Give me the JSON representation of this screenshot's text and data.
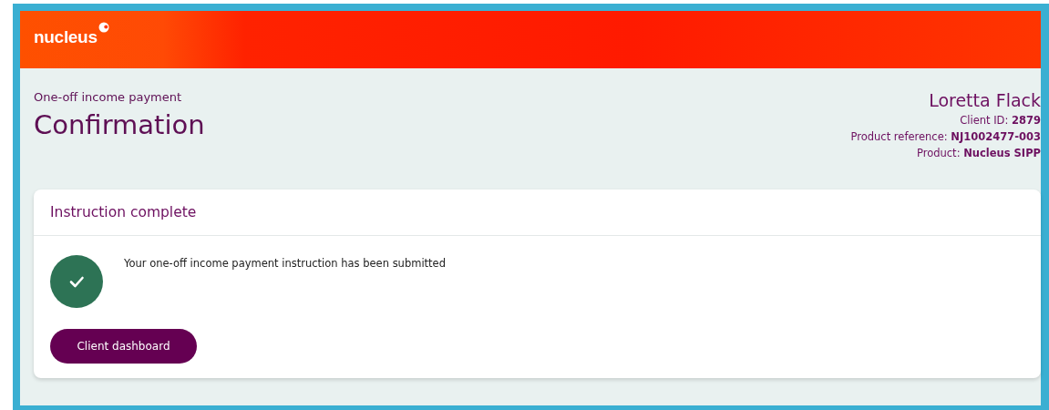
{
  "header": {
    "logo": "nucleus"
  },
  "page": {
    "subtitle": "One-off income payment",
    "title": "Confirmation"
  },
  "client": {
    "name": "Loretta Flack",
    "details": [
      "Client ID: **2879**",
      "Product reference: **NJ1002477-003**",
      "Product: **Nucleus SIPP**"
    ]
  },
  "card": {
    "title": "Instruction complete",
    "success": true,
    "message": "Your one-off income payment instruction has been submitted",
    "button": "Client dashboard"
  }
}
